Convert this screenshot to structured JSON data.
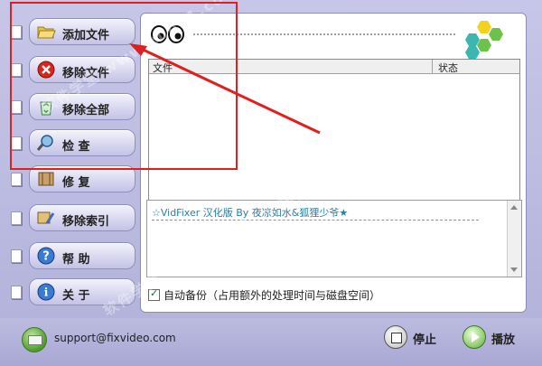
{
  "nav": {
    "items": [
      {
        "label": "添加文件",
        "icon": "folder-open-icon"
      },
      {
        "label": "移除文件",
        "icon": "red-x-icon"
      },
      {
        "label": "移除全部",
        "icon": "recycle-bin-icon"
      },
      {
        "label": "检 查",
        "icon": "magnifier-icon"
      },
      {
        "label": "修 复",
        "icon": "film-repair-icon"
      },
      {
        "label": "移除索引",
        "icon": "index-tool-icon"
      },
      {
        "label": "帮 助",
        "icon": "help-icon"
      },
      {
        "label": "关 于",
        "icon": "info-icon"
      }
    ]
  },
  "filelist": {
    "col_file": "文件",
    "col_status": "状态"
  },
  "log": {
    "text": "☆VidFixer 汉化版 By 夜凉如水&狐狸少爷★"
  },
  "options": {
    "backup_label": "自动备份（占用额外的处理时间与磁盘空间）",
    "backup_checked": true
  },
  "footer": {
    "support": "support@fixvideo.com",
    "stop_label": "停止",
    "play_label": "播放"
  },
  "watermark": {
    "text": "软件学堂 www.xue51.com"
  },
  "colors": {
    "highlight": "#e02020",
    "log_text": "#2a7fa6",
    "hex_yellow": "#f2d21c",
    "hex_green": "#6cc24a",
    "hex_teal": "#3bb6b0"
  }
}
